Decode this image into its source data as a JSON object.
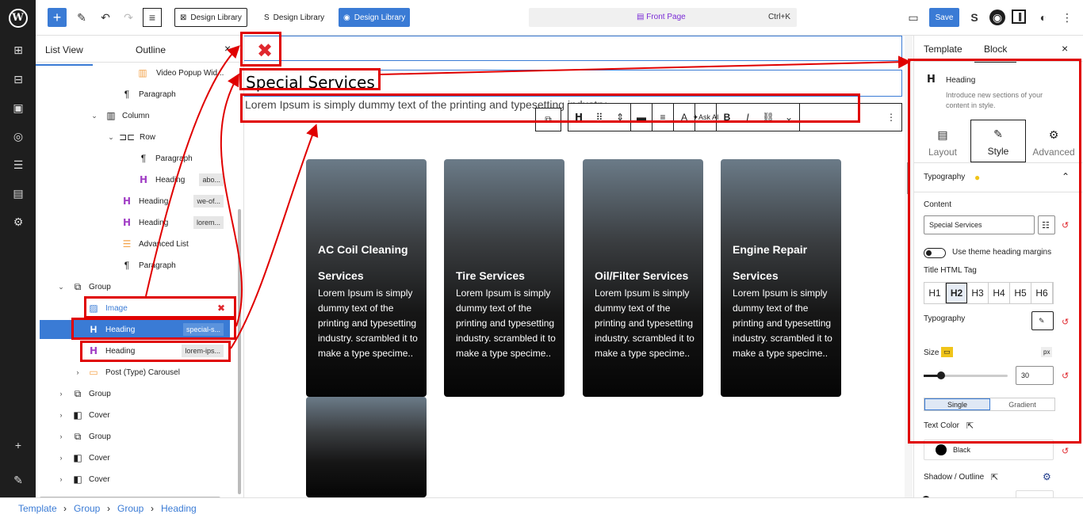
{
  "topbar": {
    "design_library": [
      "Design Library",
      "Design Library",
      "Design Library"
    ],
    "command_page": "Front Page",
    "command_shortcut": "Ctrl+K",
    "save_label": "Save"
  },
  "list_view": {
    "tabs": [
      "List View",
      "Outline"
    ],
    "close": "×",
    "items": [
      {
        "label": "Video Popup Wid...",
        "tag": ""
      },
      {
        "label": "Paragraph",
        "tag": ""
      },
      {
        "label": "Column",
        "tag": ""
      },
      {
        "label": "Row",
        "tag": ""
      },
      {
        "label": "Paragraph",
        "tag": ""
      },
      {
        "label": "Heading",
        "tag": "abo..."
      },
      {
        "label": "Heading",
        "tag": "we-of..."
      },
      {
        "label": "Heading",
        "tag": "lorem..."
      },
      {
        "label": "Advanced List",
        "tag": ""
      },
      {
        "label": "Paragraph",
        "tag": ""
      },
      {
        "label": "Group",
        "tag": ""
      },
      {
        "label": "Image",
        "tag": ""
      },
      {
        "label": "Heading",
        "tag": "special-s..."
      },
      {
        "label": "Heading",
        "tag": "lorem-ips..."
      },
      {
        "label": "Post (Type) Carousel",
        "tag": ""
      },
      {
        "label": "Group",
        "tag": ""
      },
      {
        "label": "Cover",
        "tag": ""
      },
      {
        "label": "Group",
        "tag": ""
      },
      {
        "label": "Cover",
        "tag": ""
      },
      {
        "label": "Cover",
        "tag": ""
      }
    ]
  },
  "canvas": {
    "heading": "Special Services",
    "paragraph": "Lorem Ipsum is simply dummy text of the printing and typesetting industry.",
    "toolbar_ask": "Ask AI",
    "cards": [
      {
        "title": "AC Coil Cleaning Services",
        "text": "Lorem Ipsum is simply dummy text of the printing and typesetting industry. scrambled it to make a type specime.."
      },
      {
        "title": "Tire Services",
        "text": "Lorem Ipsum is simply dummy text of the printing and typesetting industry. scrambled it to make a type specime.."
      },
      {
        "title": "Oil/Filter Services",
        "text": "Lorem Ipsum is simply dummy text of the printing and typesetting industry. scrambled it to make a type specime.."
      },
      {
        "title": "Engine Repair Services",
        "text": "Lorem Ipsum is simply dummy text of the printing and typesetting industry. scrambled it to make a type specime.."
      }
    ]
  },
  "right_panel": {
    "tabs": [
      "Template",
      "Block"
    ],
    "close": "×",
    "block_name": "Heading",
    "block_desc": "Introduce new sections of your content in style.",
    "segments": [
      "Layout",
      "Style",
      "Advanced"
    ],
    "typography_section": "Typography",
    "content_label": "Content",
    "content_value": "Special Services",
    "theme_margins_label": "Use theme heading margins",
    "title_tag_label": "Title HTML Tag",
    "heading_tags": [
      "H1",
      "H2",
      "H3",
      "H4",
      "H5",
      "H6"
    ],
    "typography_label": "Typography",
    "size_label": "Size",
    "size_unit": "px",
    "size_value": "30",
    "fill_modes": [
      "Single",
      "Gradient"
    ],
    "text_color_label": "Text Color",
    "text_color_value": "Black",
    "shadow_label": "Shadow / Outline"
  },
  "breadcrumb": [
    "Template",
    "Group",
    "Group",
    "Heading"
  ],
  "colors": {
    "accent": "#3a7bd5",
    "annotation": "#e00000",
    "heading_icon": "#a13ec5"
  }
}
